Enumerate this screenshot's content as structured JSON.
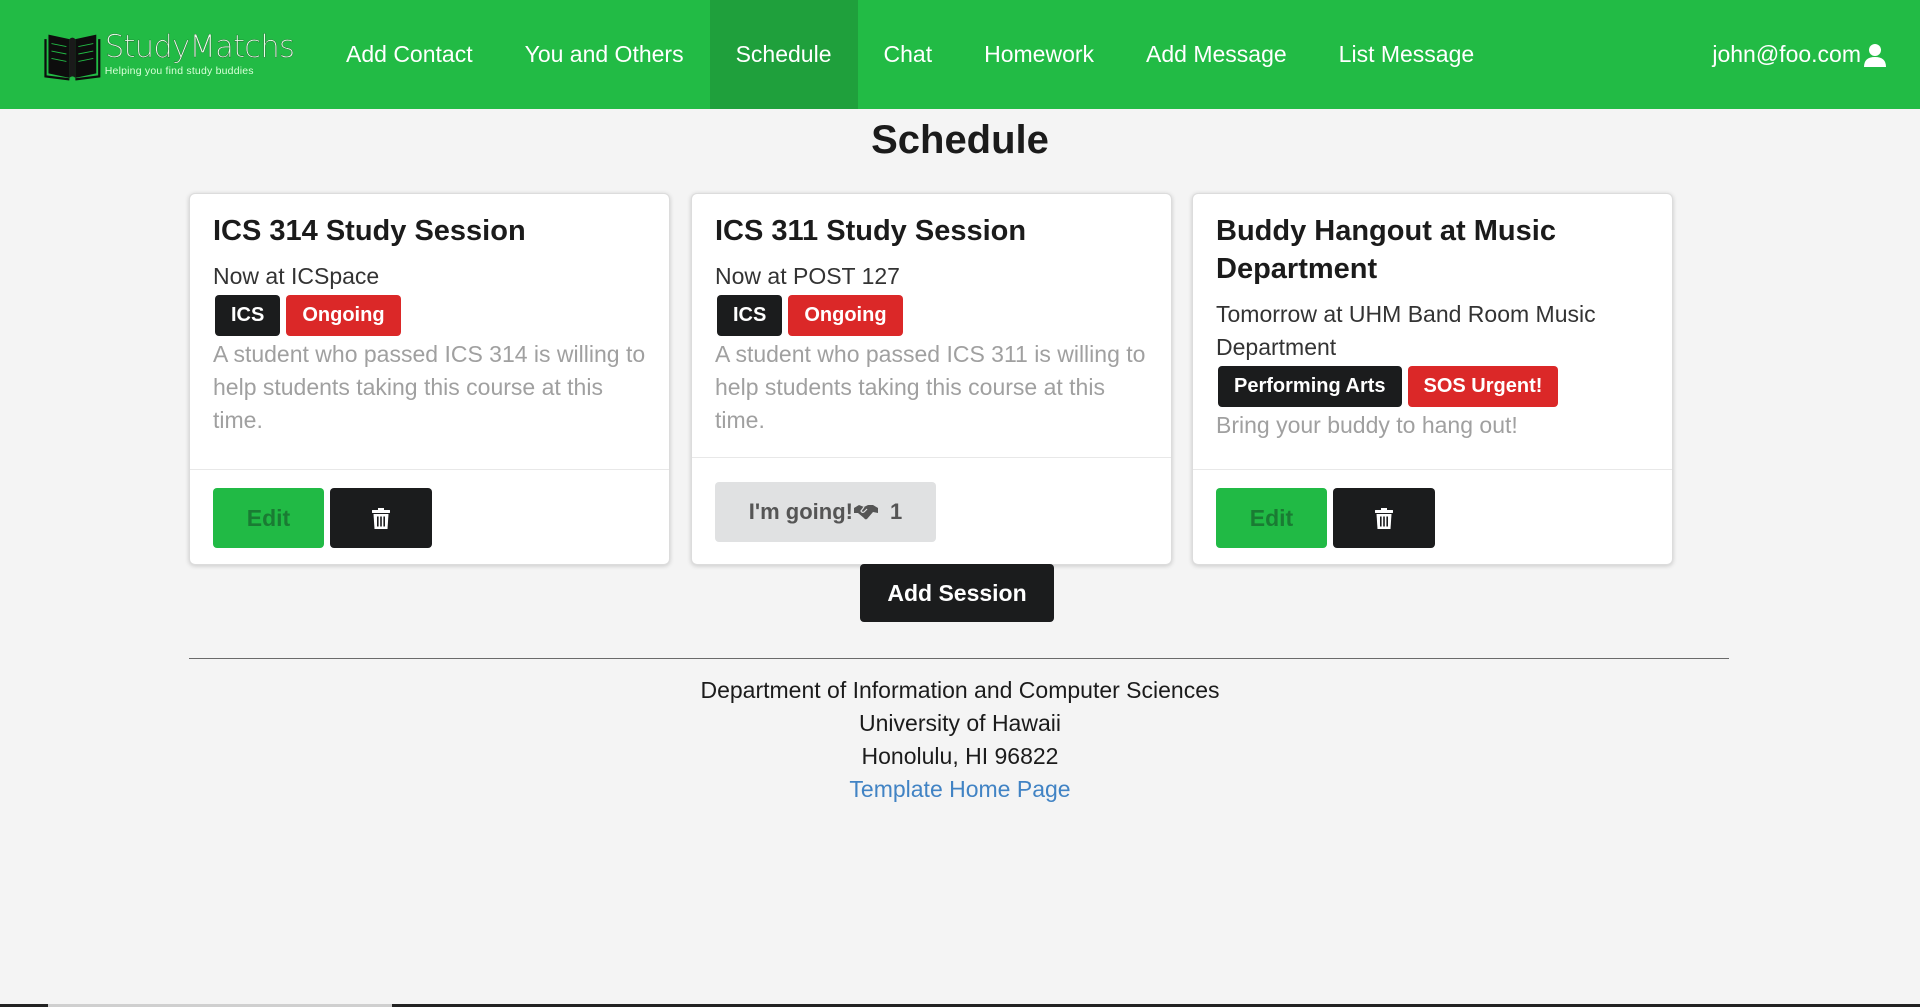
{
  "brand": {
    "name": "StudyMatchs",
    "tagline": "Helping you find study buddies"
  },
  "nav": {
    "items": [
      {
        "label": "Add Contact"
      },
      {
        "label": "You and Others"
      },
      {
        "label": "Schedule",
        "active": true
      },
      {
        "label": "Chat"
      },
      {
        "label": "Homework"
      },
      {
        "label": "Add Message"
      },
      {
        "label": "List Message"
      }
    ],
    "user": "john@foo.com"
  },
  "page": {
    "title": "Schedule"
  },
  "cards": [
    {
      "title": "ICS 314 Study Session",
      "meta": "Now at ICSpace",
      "labels": [
        {
          "text": "ICS",
          "color": "#1b1c1d"
        },
        {
          "text": "Ongoing",
          "color": "#db2828"
        }
      ],
      "description": "A student who passed ICS 314 is willing to help students taking this course at this time.",
      "actions": {
        "edit": "Edit",
        "delete_icon": "trash-icon"
      }
    },
    {
      "title": "ICS 311 Study Session",
      "meta": "Now at POST 127",
      "labels": [
        {
          "text": "ICS",
          "color": "#1b1c1d"
        },
        {
          "text": "Ongoing",
          "color": "#db2828"
        }
      ],
      "description": "A student who passed ICS 311 is willing to help students taking this course at this time.",
      "actions": {
        "going": "I'm going!",
        "going_icon": "handshake-icon",
        "going_count": "1"
      }
    },
    {
      "title": "Buddy Hangout at Music Department",
      "meta": "Tomorrow at UHM Band Room Music Department",
      "labels": [
        {
          "text": "Performing Arts",
          "color": "#1b1c1d"
        },
        {
          "text": "SOS Urgent!",
          "color": "#db2828"
        }
      ],
      "description": "Bring your buddy to hang out!",
      "actions": {
        "edit": "Edit",
        "delete_icon": "trash-icon"
      }
    }
  ],
  "add_session": "Add Session",
  "footer": {
    "line1": "Department of Information and Computer Sciences",
    "line2": "University of Hawaii",
    "line3": "Honolulu, HI 96822",
    "link": "Template Home Page"
  },
  "colors": {
    "navbar": "#22bb45",
    "navbar_active": "#1fa03c",
    "edit_button": "#21ba45",
    "dark": "#1b1c1d",
    "red": "#db2828",
    "link": "#4183c4"
  }
}
